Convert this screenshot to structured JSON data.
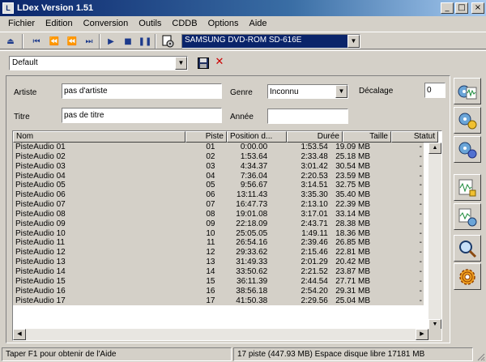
{
  "window": {
    "title": "LDex Version 1.51"
  },
  "menu": [
    "Fichier",
    "Edition",
    "Conversion",
    "Outils",
    "CDDB",
    "Options",
    "Aide"
  ],
  "toolbar": {
    "drive": "SAMSUNG DVD-ROM SD-616E"
  },
  "profile": {
    "selected": "Default"
  },
  "form": {
    "artist_label": "Artiste",
    "artist_value": "pas d'artiste",
    "genre_label": "Genre",
    "genre_value": "Inconnu",
    "offset_label": "Décalage",
    "offset_value": "0",
    "title_label": "Titre",
    "title_value": "pas de titre",
    "year_label": "Année",
    "year_value": ""
  },
  "columns": [
    "Nom",
    "Piste",
    "Position d...",
    "Durée",
    "Taille",
    "Statut"
  ],
  "tracks": [
    [
      "PisteAudio 01",
      "01",
      "0:00.00",
      "1:53.54",
      "19.09 MB",
      "-"
    ],
    [
      "PisteAudio 02",
      "02",
      "1:53.64",
      "2:33.48",
      "25.18 MB",
      "-"
    ],
    [
      "PisteAudio 03",
      "03",
      "4:34.37",
      "3:01.42",
      "30.54 MB",
      "-"
    ],
    [
      "PisteAudio 04",
      "04",
      "7:36.04",
      "2:20.53",
      "23.59 MB",
      "-"
    ],
    [
      "PisteAudio 05",
      "05",
      "9:56.67",
      "3:14.51",
      "32.75 MB",
      "-"
    ],
    [
      "PisteAudio 06",
      "06",
      "13:11.43",
      "3:35.30",
      "35.40 MB",
      "-"
    ],
    [
      "PisteAudio 07",
      "07",
      "16:47.73",
      "2:13.10",
      "22.39 MB",
      "-"
    ],
    [
      "PisteAudio 08",
      "08",
      "19:01.08",
      "3:17.01",
      "33.14 MB",
      "-"
    ],
    [
      "PisteAudio 09",
      "09",
      "22:18.09",
      "2:43.71",
      "28.38 MB",
      "-"
    ],
    [
      "PisteAudio 10",
      "10",
      "25:05.05",
      "1:49.11",
      "18.36 MB",
      "-"
    ],
    [
      "PisteAudio 11",
      "11",
      "26:54.16",
      "2:39.46",
      "26.85 MB",
      "-"
    ],
    [
      "PisteAudio 12",
      "12",
      "29:33.62",
      "2:15.46",
      "22.81 MB",
      "-"
    ],
    [
      "PisteAudio 13",
      "13",
      "31:49.33",
      "2:01.29",
      "20.42 MB",
      "-"
    ],
    [
      "PisteAudio 14",
      "14",
      "33:50.62",
      "2:21.52",
      "23.87 MB",
      "-"
    ],
    [
      "PisteAudio 15",
      "15",
      "36:11.39",
      "2:44.54",
      "27.71 MB",
      "-"
    ],
    [
      "PisteAudio 16",
      "16",
      "38:56.18",
      "2:54.20",
      "29.31 MB",
      "-"
    ],
    [
      "PisteAudio 17",
      "17",
      "41:50.38",
      "2:29.56",
      "25.04 MB",
      "-"
    ]
  ],
  "status": {
    "hint": "Taper F1 pour obtenir de l'Aide",
    "summary": "17 piste (447.93 MB) Espace disque libre 17181 MB"
  }
}
